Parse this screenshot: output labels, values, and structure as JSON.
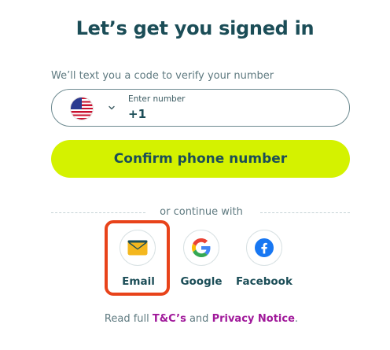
{
  "title": "Let’s get you signed in",
  "phone": {
    "hint": "We’ll text you a code to verify your number",
    "country_flag_icon": "us-flag-icon",
    "number_label": "Enter number",
    "number_value": "+1"
  },
  "confirm_button": "Confirm phone number",
  "divider_text": "or continue with",
  "social": [
    {
      "label": "Email",
      "icon": "envelope-icon"
    },
    {
      "label": "Google",
      "icon": "google-icon"
    },
    {
      "label": "Facebook",
      "icon": "facebook-icon"
    }
  ],
  "footer": {
    "prefix": "Read full",
    "tc_link": "T&C’s",
    "and": "and",
    "privacy_link": "Privacy Notice",
    "suffix": "."
  },
  "colors": {
    "primary_text": "#1b4d57",
    "confirm_button_bg": "#d4f200",
    "link": "#a0189a",
    "highlight": "#e8431a",
    "envelope": "#f4b71e"
  }
}
